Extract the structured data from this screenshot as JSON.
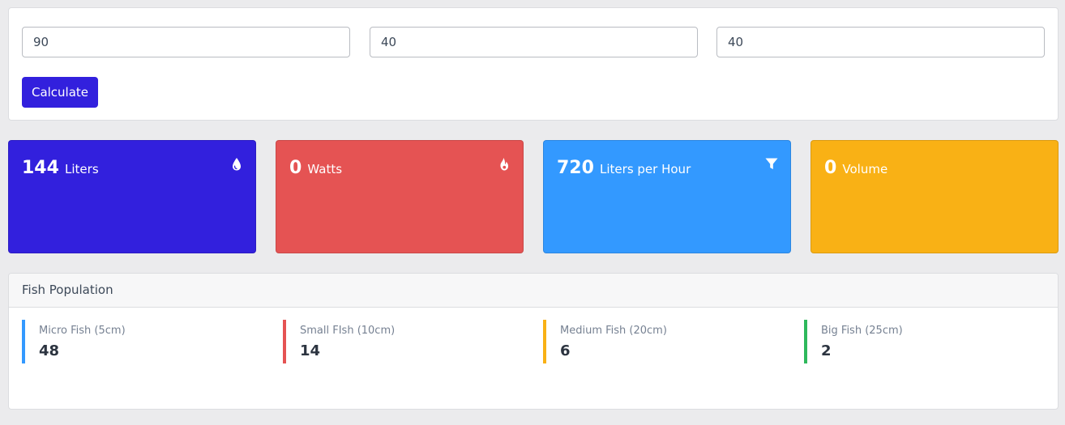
{
  "inputs": {
    "field1": "90",
    "field2": "40",
    "field3": "40",
    "calculate_label": "Calculate"
  },
  "stats": [
    {
      "value": "144",
      "unit": "Liters",
      "icon": "water-drop-icon",
      "color": "#3220dd"
    },
    {
      "value": "0",
      "unit": "Watts",
      "icon": "fire-icon",
      "color": "#e55353"
    },
    {
      "value": "720",
      "unit": "Liters per Hour",
      "icon": "filter-icon",
      "color": "#3399ff"
    },
    {
      "value": "0",
      "unit": "Volume",
      "icon": "",
      "color": "#f9b115"
    }
  ],
  "fish_population": {
    "title": "Fish Population",
    "items": [
      {
        "label": "Micro Fish (5cm)",
        "count": "48",
        "color": "#3399ff"
      },
      {
        "label": "Small FIsh (10cm)",
        "count": "14",
        "color": "#e55353"
      },
      {
        "label": "Medium Fish (20cm)",
        "count": "6",
        "color": "#f9b115"
      },
      {
        "label": "Big Fish (25cm)",
        "count": "2",
        "color": "#2eb85c"
      }
    ]
  }
}
